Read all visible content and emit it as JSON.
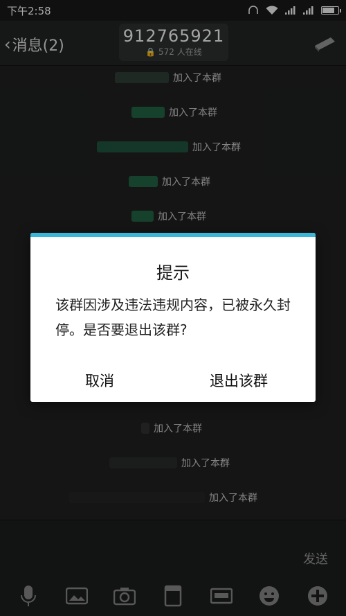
{
  "status_bar": {
    "time": "下午2:58",
    "icons": [
      "headphones-icon",
      "wifi-icon",
      "signal-icon",
      "signal-icon",
      "battery-icon"
    ],
    "battery_level": 0.7
  },
  "header": {
    "back_label": "消息(2)",
    "title": "912765921",
    "subtitle": "🔒 572 人在线"
  },
  "chat": {
    "suffix": "加入了本群",
    "messages": [
      {
        "text": "加入了本群"
      },
      {
        "text": "加入了本群"
      },
      {
        "text": "加入了本群"
      },
      {
        "text": "加入了本群"
      },
      {
        "text": "加入了本群"
      },
      {
        "text": "加入了本群"
      },
      {
        "text": "加入了本群"
      },
      {
        "text": "加入了本群"
      }
    ]
  },
  "dialog": {
    "title": "提示",
    "message": "该群因涉及违法违规内容，已被永久封停。是否要退出该群?",
    "cancel_label": "取消",
    "exit_label": "退出该群",
    "accent_color": "#3ab6d9"
  },
  "input": {
    "send_label": "发送"
  },
  "toolbar": {
    "items": [
      "microphone-icon",
      "image-icon",
      "camera-icon",
      "file-icon",
      "red-packet-icon",
      "emoji-icon",
      "plus-icon"
    ]
  }
}
